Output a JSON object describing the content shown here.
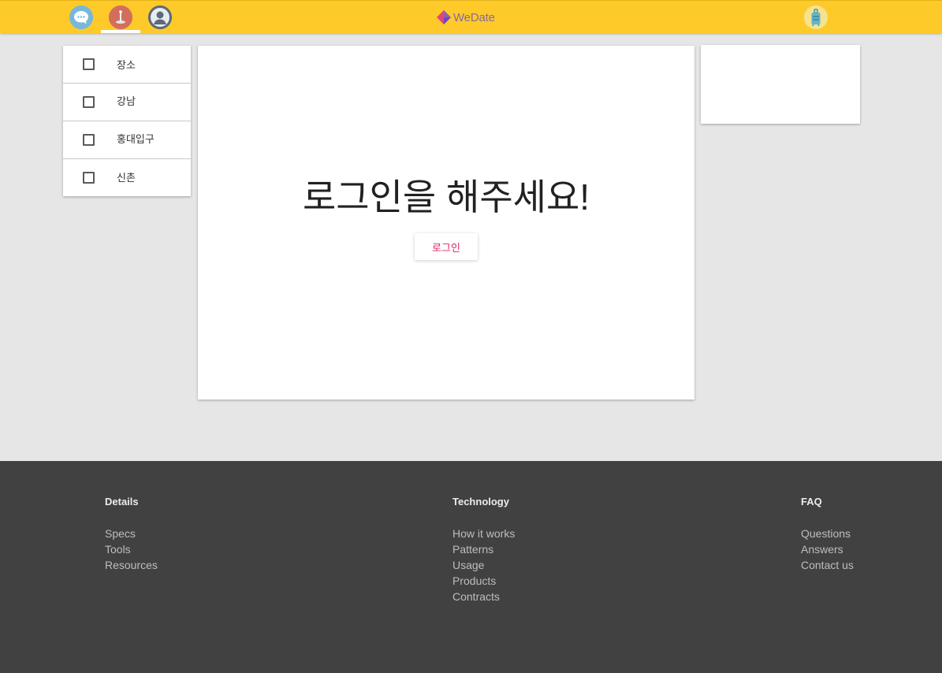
{
  "header": {
    "logo_text": "WeDate",
    "brand_color": "#fdca2a",
    "nav_icons": [
      "chat-icon",
      "place-pin-icon",
      "user-icon"
    ],
    "active_tab": "place-pin-icon",
    "right_icon": "luggage-icon"
  },
  "sidebar": {
    "items": [
      {
        "label": "장소",
        "checked": false
      },
      {
        "label": "강남",
        "checked": false
      },
      {
        "label": "홍대입구",
        "checked": false
      },
      {
        "label": "신촌",
        "checked": false
      }
    ]
  },
  "main": {
    "headline": "로그인을 해주세요!",
    "login_button": "로그인",
    "accent_color": "#e0245e"
  },
  "footer": {
    "columns": [
      {
        "heading": "Details",
        "links": [
          "Specs",
          "Tools",
          "Resources"
        ]
      },
      {
        "heading": "Technology",
        "links": [
          "How it works",
          "Patterns",
          "Usage",
          "Products",
          "Contracts"
        ]
      },
      {
        "heading": "FAQ",
        "links": [
          "Questions",
          "Answers",
          "Contact us"
        ]
      }
    ]
  }
}
